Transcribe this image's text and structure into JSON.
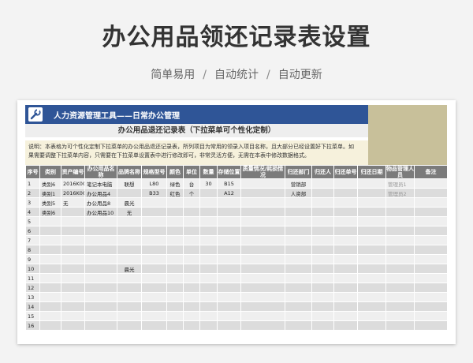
{
  "header": {
    "headline": "办公用品领还记录表设置",
    "tags": [
      "简单易用",
      "自动统计",
      "自动更新"
    ],
    "separator": "/"
  },
  "sheet": {
    "title": "人力资源管理工具——日常办公管理",
    "tool_icon": "wrench-icon",
    "subtitle": "办公用品退还记录表（下拉菜单可个性化定制）",
    "note_line1": "说明：本表格为可个性化定制下拉菜单的办公用品退还记录表，所列项目为常用的领录入项目名称，且大部分已经设置好下拉菜单。如",
    "note_line2": "果需要调整下拉菜单内容，只需要在下拉菜单设置表中进行修改即可，非常灵活方便，无需在本表中修改数据格式。",
    "colors": {
      "title_bar": "#2f5597",
      "khaki": "#c8c09a",
      "header_row": "#7b7b7b",
      "note_bg": "#f6f1dc"
    }
  },
  "table": {
    "columns": [
      "序号",
      "类别",
      "资产编号",
      "办公用品名称",
      "品牌名称",
      "规格型号",
      "颜色",
      "单位",
      "数量",
      "存储位置",
      "质量情况/耗损情况",
      "归还部门",
      "归还人",
      "归还单号",
      "归还日期",
      "物品管理人员",
      "备注"
    ],
    "rows": [
      [
        "1",
        "类别6",
        "2016K006",
        "笔记本电脑",
        "联想",
        "L80",
        "绿色",
        "台",
        "30",
        "B15",
        "",
        "营销部",
        "",
        "",
        "",
        "管理员1",
        ""
      ],
      [
        "2",
        "类别1",
        "2016K004",
        "办公用品4",
        "",
        "B33",
        "红色",
        "个",
        "",
        "A12",
        "",
        "人资部",
        "",
        "",
        "",
        "管理员2",
        ""
      ],
      [
        "3",
        "类别5",
        "无",
        "办公用品8",
        "晨光",
        "",
        "",
        "",
        "",
        "",
        "",
        "",
        "",
        "",
        "",
        "",
        ""
      ],
      [
        "4",
        "类别6",
        "",
        "办公用品10",
        "无",
        "",
        "",
        "",
        "",
        "",
        "",
        "",
        "",
        "",
        "",
        "",
        ""
      ],
      [
        "5",
        "",
        "",
        "",
        "",
        "",
        "",
        "",
        "",
        "",
        "",
        "",
        "",
        "",
        "",
        "",
        ""
      ],
      [
        "6",
        "",
        "",
        "",
        "",
        "",
        "",
        "",
        "",
        "",
        "",
        "",
        "",
        "",
        "",
        "",
        ""
      ],
      [
        "7",
        "",
        "",
        "",
        "",
        "",
        "",
        "",
        "",
        "",
        "",
        "",
        "",
        "",
        "",
        "",
        ""
      ],
      [
        "8",
        "",
        "",
        "",
        "",
        "",
        "",
        "",
        "",
        "",
        "",
        "",
        "",
        "",
        "",
        "",
        ""
      ],
      [
        "9",
        "",
        "",
        "",
        "",
        "",
        "",
        "",
        "",
        "",
        "",
        "",
        "",
        "",
        "",
        "",
        ""
      ],
      [
        "10",
        "",
        "",
        "",
        "晨光",
        "",
        "",
        "",
        "",
        "",
        "",
        "",
        "",
        "",
        "",
        "",
        ""
      ],
      [
        "11",
        "",
        "",
        "",
        "",
        "",
        "",
        "",
        "",
        "",
        "",
        "",
        "",
        "",
        "",
        "",
        ""
      ],
      [
        "12",
        "",
        "",
        "",
        "",
        "",
        "",
        "",
        "",
        "",
        "",
        "",
        "",
        "",
        "",
        "",
        ""
      ],
      [
        "13",
        "",
        "",
        "",
        "",
        "",
        "",
        "",
        "",
        "",
        "",
        "",
        "",
        "",
        "",
        "",
        ""
      ],
      [
        "14",
        "",
        "",
        "",
        "",
        "",
        "",
        "",
        "",
        "",
        "",
        "",
        "",
        "",
        "",
        "",
        ""
      ],
      [
        "15",
        "",
        "",
        "",
        "",
        "",
        "",
        "",
        "",
        "",
        "",
        "",
        "",
        "",
        "",
        "",
        ""
      ],
      [
        "16",
        "",
        "",
        "",
        "",
        "",
        "",
        "",
        "",
        "",
        "",
        "",
        "",
        "",
        "",
        "",
        ""
      ]
    ]
  }
}
